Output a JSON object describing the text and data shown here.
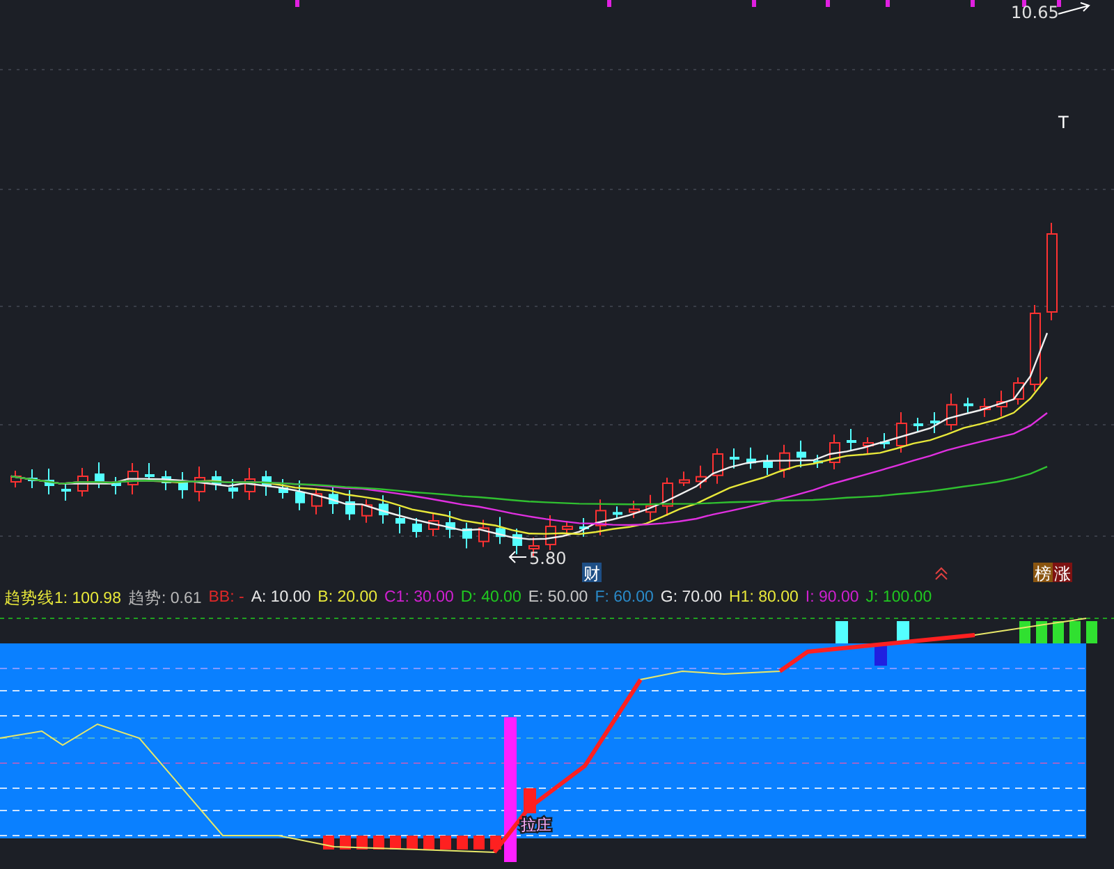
{
  "price_chart": {
    "high_label": "10.65",
    "low_label": "5.80",
    "top_marker": "T",
    "event_tags": [
      {
        "text": "财",
        "color": "#1e4f86"
      },
      {
        "text": "榜",
        "color": "#8a5510"
      },
      {
        "text": "涨",
        "color": "#7d1212"
      }
    ]
  },
  "legend": [
    {
      "label": "趋势线1:",
      "value": "100.98",
      "color": "#e8e83a"
    },
    {
      "label": "趋势:",
      "value": "0.61",
      "color": "#b8b8b8"
    },
    {
      "label": "BB:",
      "value": "-",
      "color": "#e02828"
    },
    {
      "label": "A:",
      "value": "10.00",
      "color": "#e8e8e8"
    },
    {
      "label": "B:",
      "value": "20.00",
      "color": "#e8e83a"
    },
    {
      "label": "C1:",
      "value": "30.00",
      "color": "#d020d0"
    },
    {
      "label": "D:",
      "value": "40.00",
      "color": "#20c820"
    },
    {
      "label": "E:",
      "value": "50.00",
      "color": "#c8c8c8"
    },
    {
      "label": "F:",
      "value": "60.00",
      "color": "#2a8ac8"
    },
    {
      "label": "G:",
      "value": "70.00",
      "color": "#e8e8e8"
    },
    {
      "label": "H1:",
      "value": "80.00",
      "color": "#e8e83a"
    },
    {
      "label": "I:",
      "value": "90.00",
      "color": "#d020d0"
    },
    {
      "label": "J:",
      "value": "100.00",
      "color": "#20c820"
    }
  ],
  "indicator": {
    "signal_label": "拉庄"
  }
}
